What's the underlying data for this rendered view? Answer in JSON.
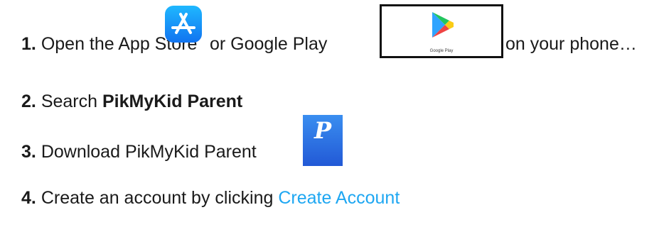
{
  "steps": [
    {
      "number": "1.",
      "text_a": "Open the App Store",
      "text_b": "or Google Play",
      "text_c": "on your phone…"
    },
    {
      "number": "2.",
      "text_a": "Search",
      "bold_text": "PikMyKid Parent"
    },
    {
      "number": "3.",
      "text_a": "Download PikMyKid Parent"
    },
    {
      "number": "4.",
      "text_a": "Create an account by clicking",
      "link_text": "Create Account"
    }
  ],
  "icons": {
    "app_store": "app-store-icon",
    "google_play": "google-play-icon",
    "google_play_caption": "Google Play",
    "pikmykid": "pikmykid-parent-icon",
    "pikmykid_letter": "P"
  },
  "colors": {
    "link": "#1ea7f2",
    "app_store_gradient": [
      "#1fb8ff",
      "#1173f0"
    ],
    "pikmykid_gradient": [
      "#3a8ef0",
      "#2259d6"
    ]
  }
}
